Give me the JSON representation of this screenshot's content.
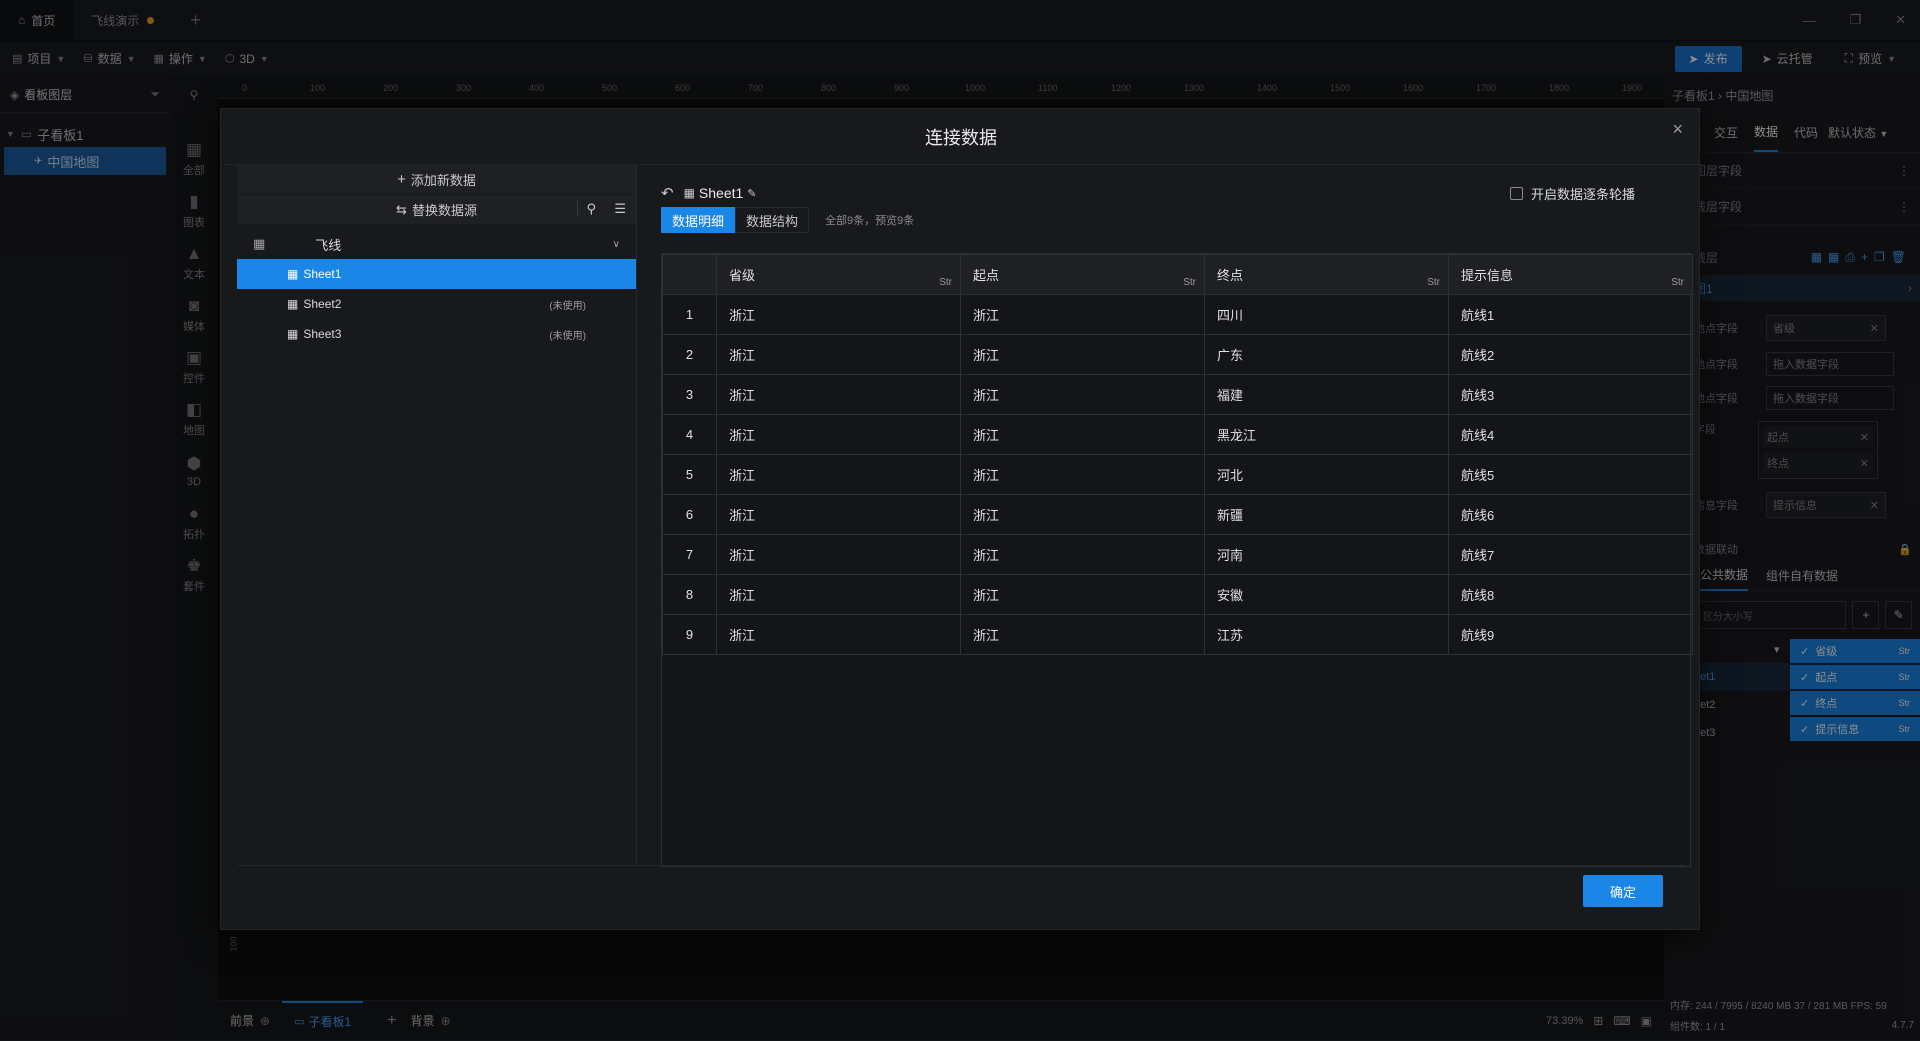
{
  "titlebar": {
    "tabs": [
      {
        "label": "首页",
        "icon": "home-icon"
      },
      {
        "label": "飞线演示",
        "unsaved": true
      }
    ],
    "window_controls": [
      "minimize-icon",
      "restore-icon",
      "close-icon"
    ]
  },
  "menubar": {
    "items": [
      {
        "label": "项目",
        "icon": "file-icon"
      },
      {
        "label": "数据",
        "icon": "database-icon"
      },
      {
        "label": "操作",
        "icon": "grid-icon"
      },
      {
        "label": "3D",
        "icon": "cube-icon"
      }
    ],
    "publish": "发布",
    "cloud": "云托管",
    "preview": "预览"
  },
  "left": {
    "title": "看板图层",
    "tree": [
      {
        "label": "子看板1",
        "level": 0
      },
      {
        "label": "中国地图",
        "level": 1,
        "selected": true
      }
    ],
    "icon_items": [
      "全部",
      "图表",
      "文本",
      "媒体",
      "控件",
      "地图",
      "3D",
      "拓扑",
      "套件"
    ]
  },
  "ruler": {
    "ticks": [
      "0",
      "100",
      "200",
      "300",
      "400",
      "500",
      "600",
      "700",
      "800",
      "900",
      "1000",
      "1100",
      "1200",
      "1300",
      "1400",
      "1500",
      "1600",
      "1700",
      "1800",
      "1900"
    ]
  },
  "right": {
    "breadcrumb": "子看板1 › 中国地图",
    "tabs": [
      "交互",
      "数据",
      "代码"
    ],
    "state": "默认状态",
    "rows": [
      "图层字段",
      "线层字段"
    ],
    "layer_label": "线层",
    "layer_item": "图1",
    "fields": [
      {
        "label": "他点字段",
        "chips": [
          "省级"
        ]
      },
      {
        "label": "他点字段",
        "placeholder": "拖入数据字段"
      },
      {
        "label": "他点字段",
        "placeholder": "拖入数据字段"
      },
      {
        "label": "字段",
        "chips": [
          "起点",
          "终点"
        ]
      },
      {
        "label": "信息字段",
        "chips": [
          "提示信息"
        ]
      }
    ],
    "linkage": "数据联动",
    "data_tabs": [
      "公共数据",
      "组件自有数据"
    ],
    "search_placeholder": "区分大小写",
    "sheets_list": [
      "eet1",
      "eet2",
      "eet3"
    ],
    "field_chips": [
      {
        "label": "省级",
        "type": "Str"
      },
      {
        "label": "起点",
        "type": "Str"
      },
      {
        "label": "终点",
        "type": "Str"
      },
      {
        "label": "提示信息",
        "type": "Str"
      }
    ],
    "stats": "内存: 244 / 7995 / 8240 MB 37 / 281 MB   FPS: 59",
    "components": "组件数: 1 / 1",
    "version": "4.7.7"
  },
  "modal": {
    "title": "连接数据",
    "add": "添加新数据",
    "replace": "替换数据源",
    "group": "飞线",
    "sheets": [
      {
        "name": "Sheet1",
        "active": true,
        "note": ""
      },
      {
        "name": "Sheet2",
        "active": false,
        "note": "(未使用)"
      },
      {
        "name": "Sheet3",
        "active": false,
        "note": "(未使用)"
      }
    ],
    "current_sheet": "Sheet1",
    "carousel": "开启数据逐条轮播",
    "tab_detail": "数据明细",
    "tab_structure": "数据结构",
    "summary": "全部9条，预览9条",
    "columns": [
      "省级",
      "起点",
      "终点",
      "提示信息"
    ],
    "col_type": "Str",
    "rows": [
      [
        "1",
        "浙江",
        "浙江",
        "四川",
        "航线1"
      ],
      [
        "2",
        "浙江",
        "浙江",
        "广东",
        "航线2"
      ],
      [
        "3",
        "浙江",
        "浙江",
        "福建",
        "航线3"
      ],
      [
        "4",
        "浙江",
        "浙江",
        "黑龙江",
        "航线4"
      ],
      [
        "5",
        "浙江",
        "浙江",
        "河北",
        "航线5"
      ],
      [
        "6",
        "浙江",
        "浙江",
        "新疆",
        "航线6"
      ],
      [
        "7",
        "浙江",
        "浙江",
        "河南",
        "航线7"
      ],
      [
        "8",
        "浙江",
        "浙江",
        "安徽",
        "航线8"
      ],
      [
        "9",
        "浙江",
        "浙江",
        "江苏",
        "航线9"
      ]
    ],
    "ok": "确定"
  },
  "bottom": {
    "front": "前景",
    "board": "子看板1",
    "back": "背景",
    "zoom": "73.39%",
    "vruler": "100"
  }
}
